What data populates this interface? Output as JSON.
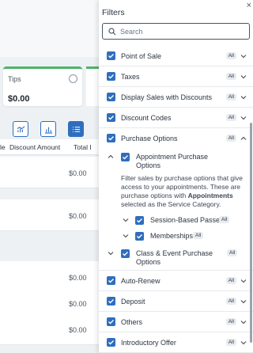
{
  "background": {
    "tips_card": {
      "label": "Tips",
      "value": "$0.00"
    },
    "table": {
      "headers": [
        "le",
        "Discount Amount",
        "Total I"
      ],
      "rows": [
        {
          "amount": "$0.00"
        },
        {
          "amount": "$0.00"
        },
        {
          "amount": "$0.00"
        },
        {
          "amount": "$0.00"
        },
        {
          "amount": "$0.00"
        }
      ]
    }
  },
  "filters": {
    "title": "Filters",
    "close_glyph": "×",
    "search_placeholder": "Search",
    "items": [
      {
        "label": "Point of Sale",
        "badge": "All"
      },
      {
        "label": "Taxes",
        "badge": "All"
      },
      {
        "label": "Display Sales with Discounts",
        "badge": "All"
      },
      {
        "label": "Discount Codes",
        "badge": "All"
      },
      {
        "label": "Purchase Options",
        "badge": "All"
      }
    ],
    "purchase_options": {
      "appointment": {
        "label_line1": "Appointment Purchase",
        "label_line2": "Options",
        "description_part1": "Filter sales by purchase options that give access to your appointments. These are purchase options with ",
        "description_bold": "Appointments",
        "description_part2": " selected as the Service Category.",
        "children": [
          {
            "label": "Session-Based Passes",
            "badge": "All"
          },
          {
            "label": "Memberships",
            "badge": "All"
          }
        ]
      },
      "class_event": {
        "label_line1": "Class & Event Purchase",
        "label_line2": "Options",
        "badge": "All"
      }
    },
    "more_items": [
      {
        "label": "Auto-Renew",
        "badge": "All"
      },
      {
        "label": "Deposit",
        "badge": "All"
      },
      {
        "label": "Others",
        "badge": "All"
      },
      {
        "label": "Introductory Offer",
        "badge": "All"
      }
    ]
  },
  "colors": {
    "accent": "#2f6ebd",
    "tips_border": "#4fb36a"
  }
}
